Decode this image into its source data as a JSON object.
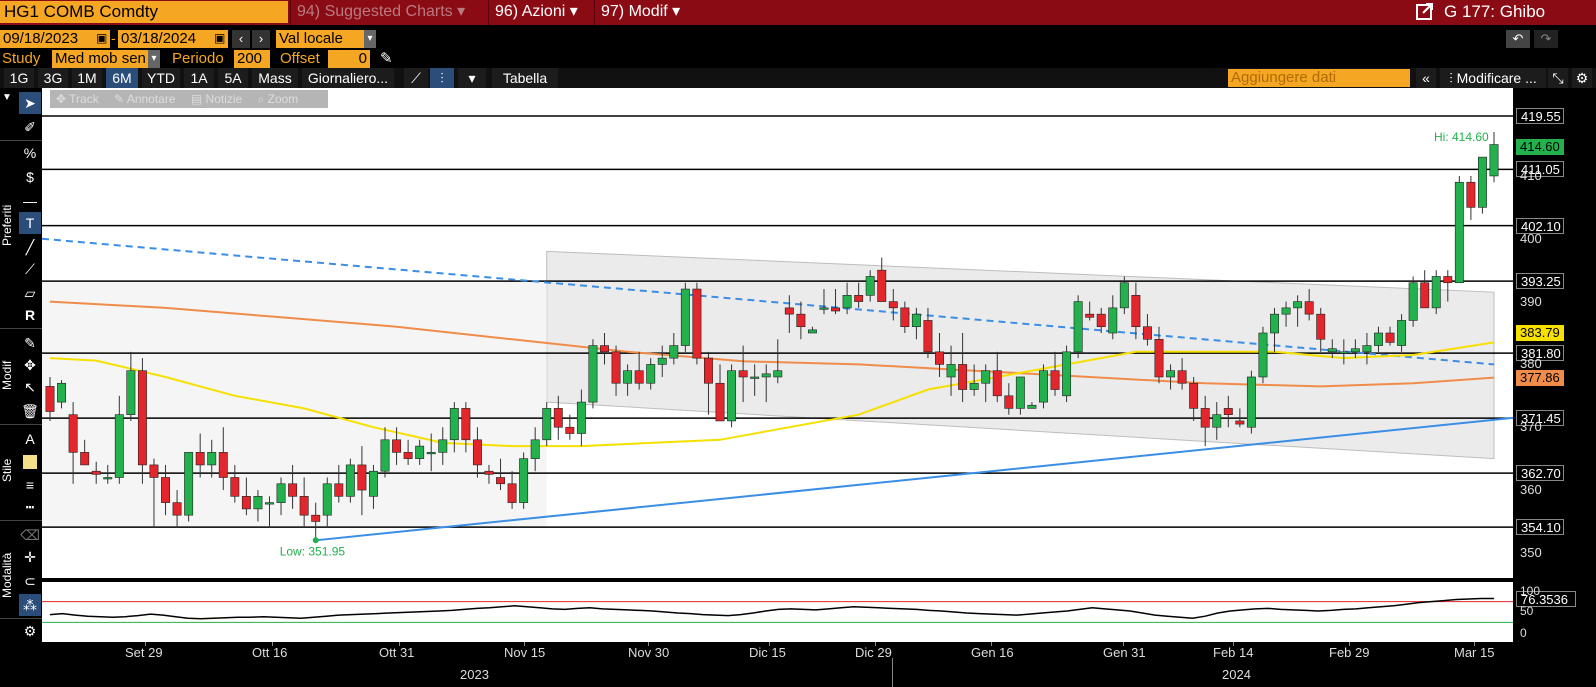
{
  "header": {
    "ticker": "HG1 COMB Comdty",
    "menu_suggested": "94) Suggested Charts",
    "menu_azioni": "96) Azioni",
    "menu_modif": "97) Modif",
    "window_title": "G 177: Ghibo"
  },
  "toolbar": {
    "date_start": "09/18/2023",
    "date_end": "03/18/2024",
    "currency": "Val locale",
    "study_label": "Study",
    "study_value": "Med mob sen",
    "period_label": "Periodo",
    "period_value": "200",
    "offset_label": "Offset",
    "offset_value": "0",
    "add_data_placeholder": "Aggiungere dati",
    "modify_label": "Modificare ...",
    "table_label": "Tabella",
    "frequency_label": "Giornaliero...",
    "ranges": [
      "1G",
      "3G",
      "1M",
      "6M",
      "YTD",
      "1A",
      "5A",
      "Mass"
    ],
    "active_range": "6M"
  },
  "subtools": [
    "Track",
    "Annotare",
    "Notizie",
    "Zoom"
  ],
  "sidebar": {
    "sections": [
      "Preferiti",
      "Modif",
      "Stile",
      "Modalità"
    ]
  },
  "annotations": {
    "high": "Hi: 414.60",
    "low": "Low: 351.95"
  },
  "levels": [
    {
      "value": "419.55",
      "price": 419.55
    },
    {
      "value": "414.60",
      "price": 414.6,
      "color": "#22b14c"
    },
    {
      "value": "411.05",
      "price": 411.05
    },
    {
      "value": "402.10",
      "price": 402.1
    },
    {
      "value": "393.25",
      "price": 393.25
    },
    {
      "value": "383.79",
      "price": 383.79,
      "color": "#e6d700"
    },
    {
      "value": "381.80",
      "price": 381.8
    },
    {
      "value": "377.86",
      "price": 377.86,
      "color": "#f08c4a"
    },
    {
      "value": "371.45",
      "price": 371.45
    },
    {
      "value": "362.70",
      "price": 362.7
    },
    {
      "value": "354.10",
      "price": 354.1
    }
  ],
  "y_ticks": [
    "410",
    "400",
    "390",
    "380",
    "370",
    "360",
    "350"
  ],
  "rsi": {
    "value": "76.3536",
    "ticks": [
      "100",
      "50",
      "0"
    ]
  },
  "x_ticks": [
    "Set 29",
    "Ott 16",
    "Ott 31",
    "Nov 15",
    "Nov 30",
    "Dic 15",
    "Dic 29",
    "Gen 16",
    "Gen 31",
    "Feb 14",
    "Feb 29",
    "Mar 15"
  ],
  "year_labels": [
    "2023",
    "2024"
  ],
  "colors": {
    "up": "#22b14c",
    "down": "#e2262b",
    "ma_fast": "#f5e000",
    "ma_slow": "#f08c4a",
    "trend": "#3a8ee6",
    "accent": "#f5a623",
    "top_bar": "#8b0b15"
  },
  "chart_data": {
    "type": "candlestick",
    "ylim": [
      346,
      424
    ],
    "candles": [
      [
        376.5,
        378,
        371,
        372.5
      ],
      [
        374,
        377.5,
        373,
        377
      ],
      [
        372,
        374,
        361,
        366
      ],
      [
        366,
        368,
        364,
        364
      ],
      [
        363,
        364.5,
        361,
        362.5
      ],
      [
        362,
        364,
        361,
        362
      ],
      [
        362,
        375,
        361,
        372
      ],
      [
        372,
        382,
        371,
        379
      ],
      [
        379,
        381,
        361,
        364
      ],
      [
        364,
        365,
        354,
        362
      ],
      [
        362,
        364,
        356,
        358
      ],
      [
        358,
        360,
        354,
        356
      ],
      [
        356,
        366,
        355,
        366
      ],
      [
        366,
        369,
        362,
        364
      ],
      [
        364,
        368,
        362,
        366
      ],
      [
        366,
        370,
        360,
        362
      ],
      [
        362,
        364,
        358,
        359
      ],
      [
        359,
        362,
        356,
        357
      ],
      [
        357,
        360,
        355,
        359
      ],
      [
        358,
        359,
        354,
        358
      ],
      [
        358,
        362,
        356,
        361
      ],
      [
        361,
        364,
        357,
        359
      ],
      [
        359,
        362,
        354,
        356
      ],
      [
        356,
        358,
        352,
        355
      ],
      [
        356,
        362,
        354,
        361
      ],
      [
        361,
        364,
        358,
        359
      ],
      [
        359,
        365,
        358,
        364
      ],
      [
        364,
        367,
        356,
        360
      ],
      [
        359,
        364,
        357,
        363
      ],
      [
        363,
        370,
        362,
        368
      ],
      [
        368,
        370,
        364,
        366
      ],
      [
        366,
        368,
        364,
        365
      ],
      [
        365,
        368,
        364,
        367
      ],
      [
        366,
        369,
        363,
        366
      ],
      [
        366,
        370,
        364,
        368
      ],
      [
        368,
        374,
        366,
        373
      ],
      [
        373,
        374,
        366,
        368
      ],
      [
        368,
        370,
        362,
        364
      ],
      [
        363,
        364,
        361,
        362.5
      ],
      [
        362,
        365,
        360,
        361
      ],
      [
        361,
        363,
        357,
        358
      ],
      [
        358,
        366,
        357,
        365
      ],
      [
        365,
        370,
        363,
        368
      ],
      [
        368,
        374,
        367,
        373
      ],
      [
        373,
        375,
        368,
        370
      ],
      [
        370,
        372,
        368,
        369
      ],
      [
        369,
        376,
        367,
        374
      ],
      [
        374,
        384,
        373,
        383
      ],
      [
        383,
        385,
        380,
        382
      ],
      [
        382,
        383,
        375,
        377
      ],
      [
        377,
        380,
        375,
        379
      ],
      [
        379,
        382,
        376,
        377
      ],
      [
        377,
        381,
        376,
        380
      ],
      [
        380,
        383,
        378,
        381
      ],
      [
        381,
        385,
        380,
        383
      ],
      [
        383,
        393,
        382,
        392
      ],
      [
        392,
        393,
        380,
        381
      ],
      [
        381,
        382,
        372,
        377
      ],
      [
        377,
        380,
        371,
        371
      ],
      [
        371,
        380,
        370,
        379
      ],
      [
        379,
        383,
        374,
        378
      ],
      [
        378,
        380,
        375,
        378
      ],
      [
        378,
        380,
        374,
        378.5
      ],
      [
        378,
        384,
        377,
        379
      ],
      [
        389,
        391,
        385,
        388
      ],
      [
        388,
        390,
        384,
        386
      ],
      [
        385,
        386,
        385,
        385.5
      ],
      [
        389,
        392,
        388,
        389
      ],
      [
        389,
        392,
        388,
        388.5
      ],
      [
        389,
        393,
        388,
        391
      ],
      [
        391,
        393,
        389,
        390
      ],
      [
        391,
        395,
        390,
        394
      ],
      [
        395,
        397,
        391,
        390
      ],
      [
        390,
        392,
        387,
        389
      ],
      [
        389,
        390,
        385,
        386
      ],
      [
        386,
        389,
        384,
        388
      ],
      [
        387,
        389,
        381,
        382
      ],
      [
        382,
        385,
        378,
        380
      ],
      [
        378,
        383,
        375,
        380
      ],
      [
        380,
        385,
        374,
        376
      ],
      [
        376,
        380,
        375,
        377
      ],
      [
        377,
        380,
        374,
        379
      ],
      [
        379,
        382,
        374,
        375
      ],
      [
        375,
        377,
        372,
        373
      ],
      [
        373,
        378,
        372,
        378
      ],
      [
        373,
        374,
        373,
        373.5
      ],
      [
        374,
        380,
        373,
        379
      ],
      [
        379,
        382,
        375,
        376
      ],
      [
        375,
        383,
        374,
        382
      ],
      [
        382,
        391,
        381,
        390
      ],
      [
        388,
        390,
        387,
        387.5
      ],
      [
        388,
        389,
        385,
        386
      ],
      [
        385,
        391,
        384,
        389
      ],
      [
        389,
        394,
        388,
        393
      ],
      [
        391,
        393,
        384,
        386
      ],
      [
        386,
        388,
        383,
        384
      ],
      [
        384,
        386,
        377,
        378
      ],
      [
        378,
        380,
        376,
        379
      ],
      [
        379,
        381,
        376,
        377
      ],
      [
        377,
        378,
        371,
        373
      ],
      [
        373,
        375,
        367,
        370
      ],
      [
        370,
        374,
        368,
        372
      ],
      [
        373,
        375,
        370,
        372
      ],
      [
        371,
        373,
        370,
        370.5
      ],
      [
        370,
        379,
        369,
        378
      ],
      [
        378,
        386,
        377,
        385
      ],
      [
        385,
        389,
        382,
        388
      ],
      [
        388,
        390,
        386,
        389
      ],
      [
        389,
        391,
        386,
        390
      ],
      [
        390,
        392,
        387,
        388
      ],
      [
        388,
        389,
        382,
        384
      ],
      [
        382,
        384,
        381,
        382.5
      ],
      [
        382,
        384,
        380,
        382
      ],
      [
        382,
        384,
        381,
        382.5
      ],
      [
        382,
        385,
        380,
        383
      ],
      [
        383,
        386,
        382,
        385
      ],
      [
        385,
        386,
        383,
        383.5
      ],
      [
        383,
        388,
        382,
        387
      ],
      [
        387,
        394,
        386,
        393
      ],
      [
        393,
        395,
        389,
        389
      ],
      [
        389,
        395,
        388,
        394
      ],
      [
        394,
        395,
        390,
        393
      ],
      [
        393,
        410,
        393,
        409
      ],
      [
        409,
        410,
        403,
        405
      ],
      [
        405,
        412,
        404,
        413
      ],
      [
        410,
        417,
        409,
        415
      ]
    ],
    "ma_fast": [
      [
        0,
        381
      ],
      [
        4,
        380.6
      ],
      [
        10,
        378
      ],
      [
        16,
        375
      ],
      [
        22,
        373
      ],
      [
        28,
        370
      ],
      [
        34,
        367.5
      ],
      [
        40,
        367
      ],
      [
        46,
        367
      ],
      [
        52,
        367.5
      ],
      [
        58,
        368
      ],
      [
        64,
        370
      ],
      [
        70,
        372
      ],
      [
        76,
        376
      ],
      [
        82,
        378
      ],
      [
        88,
        380
      ],
      [
        94,
        382
      ],
      [
        100,
        382
      ],
      [
        106,
        382
      ],
      [
        112,
        381
      ],
      [
        118,
        381.5
      ],
      [
        125,
        383.5
      ]
    ],
    "ma_slow": [
      [
        0,
        390
      ],
      [
        10,
        389
      ],
      [
        20,
        387.5
      ],
      [
        30,
        386
      ],
      [
        40,
        384
      ],
      [
        50,
        382
      ],
      [
        60,
        380.5
      ],
      [
        70,
        380
      ],
      [
        80,
        379
      ],
      [
        90,
        378
      ],
      [
        100,
        377
      ],
      [
        110,
        376.5
      ],
      [
        118,
        377
      ],
      [
        125,
        377.9
      ]
    ],
    "trend_up": [
      [
        23,
        352
      ],
      [
        125,
        371.5
      ]
    ],
    "trend_dash": [
      [
        0,
        400
      ],
      [
        125,
        380
      ]
    ],
    "channel_top": [
      [
        43,
        398
      ],
      [
        125,
        391.5
      ]
    ],
    "channel_bot": [
      [
        43,
        374
      ],
      [
        125,
        365
      ]
    ],
    "rsi_series": [
      45,
      47,
      44,
      42,
      41,
      40,
      41,
      43,
      46,
      44,
      41,
      38,
      37,
      38,
      39,
      40,
      40,
      41,
      40,
      39,
      38,
      40,
      42,
      44,
      45,
      46,
      47,
      48,
      49,
      50,
      51,
      52,
      53,
      55,
      57,
      58,
      60,
      62,
      60,
      58,
      56,
      55,
      57,
      58,
      56,
      55,
      54,
      53,
      52,
      50,
      48,
      47,
      45,
      44,
      43,
      45,
      48,
      52,
      55,
      56,
      55,
      54,
      56,
      58,
      60,
      59,
      58,
      57,
      56,
      55,
      53,
      52,
      50,
      48,
      47,
      46,
      45,
      44,
      46,
      48,
      50,
      52,
      55,
      58,
      56,
      54,
      52,
      48,
      44,
      42,
      40,
      38,
      42,
      48,
      52,
      54,
      56,
      57,
      55,
      54,
      53,
      52,
      53,
      55,
      56,
      58,
      60,
      62,
      65,
      68,
      70,
      72,
      74,
      75,
      76,
      76
    ]
  }
}
